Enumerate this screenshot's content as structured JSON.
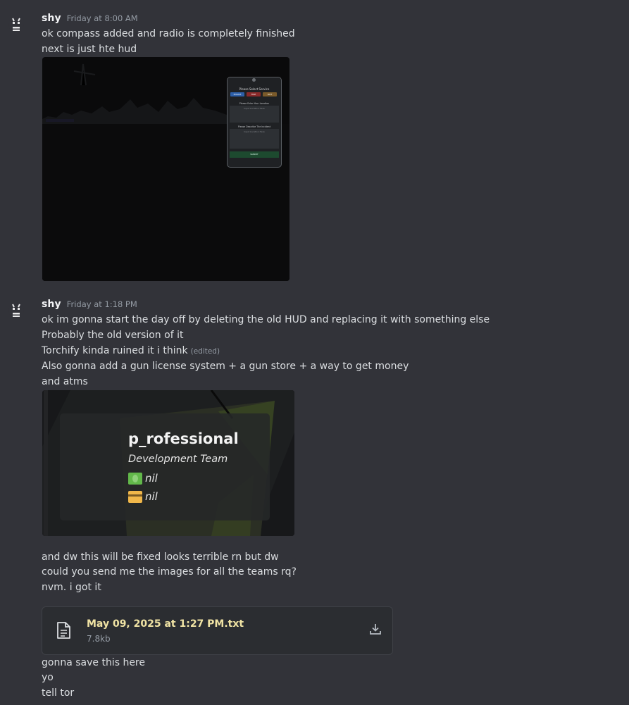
{
  "messages": [
    {
      "author": "shy",
      "timestamp": "Friday at 8:00 AM",
      "lines": [
        "ok compass added and radio is completely finished",
        "next is just hte hud"
      ],
      "attachment_text": {
        "title": "Please Select Service",
        "buttons": [
          "POLICE",
          "FIRE",
          "DOT"
        ],
        "location_label": "Please Enter Your Location",
        "location_placeholder": "Input Location Here",
        "incident_label": "Please Describe The Incident",
        "incident_placeholder": "Input Location Here",
        "submit": "SUBMIT"
      }
    },
    {
      "author": "shy",
      "timestamp": "Friday at 1:18 PM",
      "lines": [
        "ok im gonna start the day off by deleting the old HUD and replacing it with something else",
        "Probably the old version of it",
        "Torchify kinda ruined it i think",
        "Also gonna add a gun license system + a gun store + a way to get money",
        "and atms"
      ],
      "edited": "(edited)",
      "hud": {
        "brand": "p_rofessional",
        "team": "Development Team",
        "cash": "nil",
        "bank": "nil"
      },
      "followups": [
        "and dw this will be fixed looks terrible rn but dw",
        "could you send me the images for all the teams rq?",
        "nvm. i got it"
      ],
      "file": {
        "name": "May 09, 2025 at 1:27 PM.txt",
        "size": "7.8kb"
      },
      "after_file": [
        "gonna save this here",
        "yo",
        "tell tor"
      ]
    }
  ],
  "colors": {
    "background": "#323339",
    "file_name": "#f0e3a4",
    "police": "#2d5fa8",
    "fire": "#8a2a2a",
    "dot": "#7a5a2a"
  },
  "icons": [
    "avatar-icon",
    "file-icon",
    "download-icon",
    "cash-emoji-icon",
    "card-emoji-icon"
  ]
}
